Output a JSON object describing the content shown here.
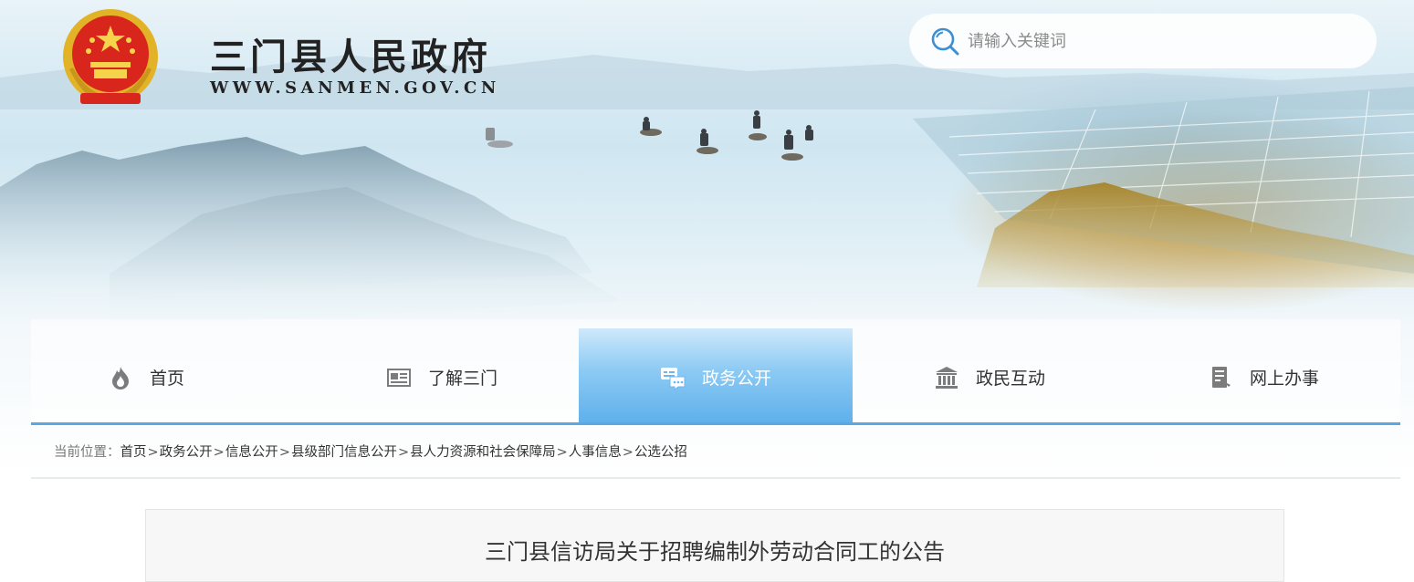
{
  "site": {
    "title": "三门县人民政府",
    "url": "WWW.SANMEN.GOV.CN"
  },
  "search": {
    "placeholder": "请输入关键词",
    "icon": "search-icon"
  },
  "nav": {
    "items": [
      {
        "label": "首页",
        "icon": "flame-icon"
      },
      {
        "label": "了解三门",
        "icon": "newspaper-icon"
      },
      {
        "label": "政务公开",
        "icon": "chat-icon",
        "active": true
      },
      {
        "label": "政民互动",
        "icon": "building-icon"
      },
      {
        "label": "网上办事",
        "icon": "document-icon"
      }
    ],
    "active_color": "#5fb0ec"
  },
  "breadcrumb": {
    "prefix": "当前位置：",
    "items": [
      "首页",
      "政务公开",
      "信息公开",
      "县级部门信息公开",
      "县人力资源和社会保障局",
      "人事信息",
      "公选公招"
    ],
    "separator": ">"
  },
  "article": {
    "title": "三门县信访局关于招聘编制外劳动合同工的公告"
  }
}
